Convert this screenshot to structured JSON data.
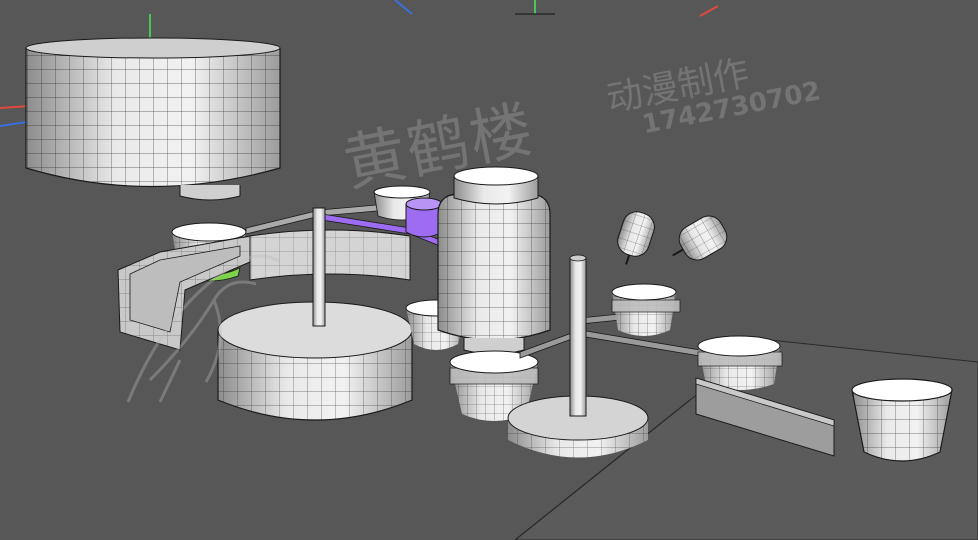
{
  "viewport": {
    "background": "#575757",
    "mesh_fill": "#f2f2f2",
    "mesh_shade": "#9a9a9a",
    "wire_color": "#1a1a1a",
    "selection_color": "#9d6cf0",
    "highlight_color": "#7fd34a",
    "axis_x_color": "#e0493f",
    "axis_y_color": "#4fc45a",
    "axis_z_color": "#3a6fe0"
  },
  "watermark": {
    "brand": "黄鹤楼",
    "subtitle": "动漫制作",
    "number": "1742730702",
    "logo": "crane-logo"
  }
}
